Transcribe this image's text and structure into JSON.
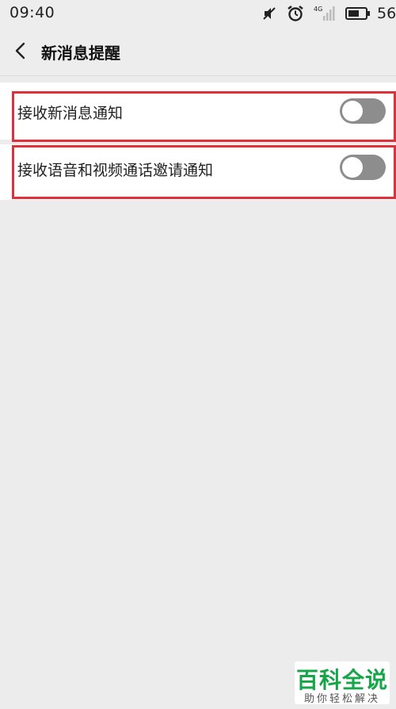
{
  "status_bar": {
    "time": "09:40",
    "battery_text": "56",
    "network_label": "4G",
    "icons": [
      "mute-icon",
      "alarm-icon",
      "signal-4g-icon",
      "battery-icon"
    ]
  },
  "header": {
    "title": "新消息提醒",
    "back_icon": "chevron-left-icon"
  },
  "settings": [
    {
      "label": "接收新消息通知",
      "enabled": false
    },
    {
      "label": "接收语音和视频通话邀请通知",
      "enabled": false
    }
  ],
  "colors": {
    "background": "#ececec",
    "card": "#ffffff",
    "toggle_off": "#8d8d8d",
    "highlight": "#e0303a",
    "watermark_green": "#17a54a"
  },
  "watermark": {
    "title": "百科全说",
    "subtitle": "助你轻松解决"
  }
}
